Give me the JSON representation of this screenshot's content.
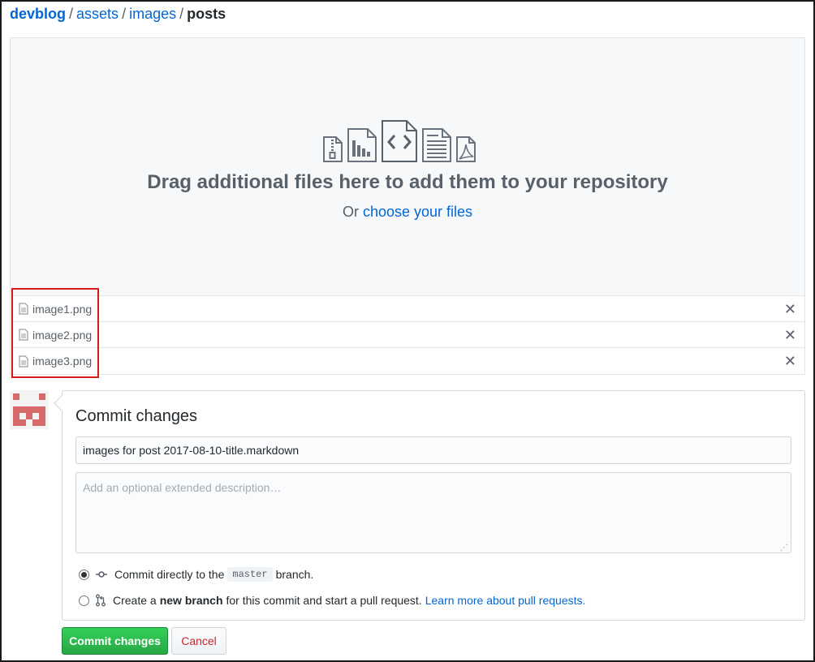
{
  "breadcrumb": {
    "repo": "devblog",
    "parts": [
      "assets",
      "images"
    ],
    "current": "posts",
    "separator": "/"
  },
  "dropzone": {
    "title": "Drag additional files here to add them to your repository",
    "prefix": "Or",
    "link": "choose your files",
    "icons": [
      "file-zip-icon",
      "file-chart-icon",
      "file-code-icon",
      "file-text-icon",
      "file-pdf-icon"
    ]
  },
  "files": [
    {
      "name": "image1.png",
      "remove": "✕"
    },
    {
      "name": "image2.png",
      "remove": "✕"
    },
    {
      "name": "image3.png",
      "remove": "✕"
    }
  ],
  "commit": {
    "heading": "Commit changes",
    "summary_value": "images for post 2017-08-10-title.markdown",
    "description_placeholder": "Add an optional extended description…",
    "option_direct": {
      "before": "Commit directly to the",
      "branch": "master",
      "after": "branch.",
      "selected": true
    },
    "option_branch": {
      "before": "Create a",
      "bold": "new branch",
      "after": "for this commit and start a pull request.",
      "link": "Learn more about pull requests.",
      "selected": false
    }
  },
  "buttons": {
    "commit": "Commit changes",
    "cancel": "Cancel"
  },
  "colors": {
    "link": "#0366d6",
    "primary_button": "#28a745",
    "cancel_text": "#cb2431",
    "highlight_box": "#d61a1a",
    "avatar": "#d66a6a"
  }
}
